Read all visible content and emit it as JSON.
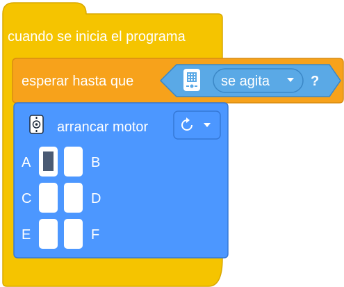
{
  "colors": {
    "event_block": "#f5c400",
    "event_block_edge": "#d9a800",
    "control_block": "#f7a21b",
    "control_block_edge": "#d98c12",
    "sensor_input": "#5aa9e6",
    "sensor_input_edge": "#3b87c6",
    "motor_block": "#4c97ff",
    "motor_block_edge": "#3578d6",
    "port_slot": "#ffffff",
    "port_selected": "#4a5a73"
  },
  "event_block": {
    "label": "cuando se inicia el programa"
  },
  "wait_block": {
    "label": "esperar hasta que",
    "sensor_icon": "hub-sensor-icon",
    "condition_value": "se agita",
    "dropdown_icon": "caret-down-icon",
    "suffix": "?"
  },
  "motor_block": {
    "icon": "motor-icon",
    "label": "arrancar motor",
    "direction_icon": "clockwise-arrow-icon",
    "dropdown_icon": "caret-down-icon",
    "ports": [
      {
        "left": "A",
        "right": "B",
        "left_selected": true,
        "right_selected": false
      },
      {
        "left": "C",
        "right": "D",
        "left_selected": false,
        "right_selected": false
      },
      {
        "left": "E",
        "right": "F",
        "left_selected": false,
        "right_selected": false
      }
    ]
  }
}
